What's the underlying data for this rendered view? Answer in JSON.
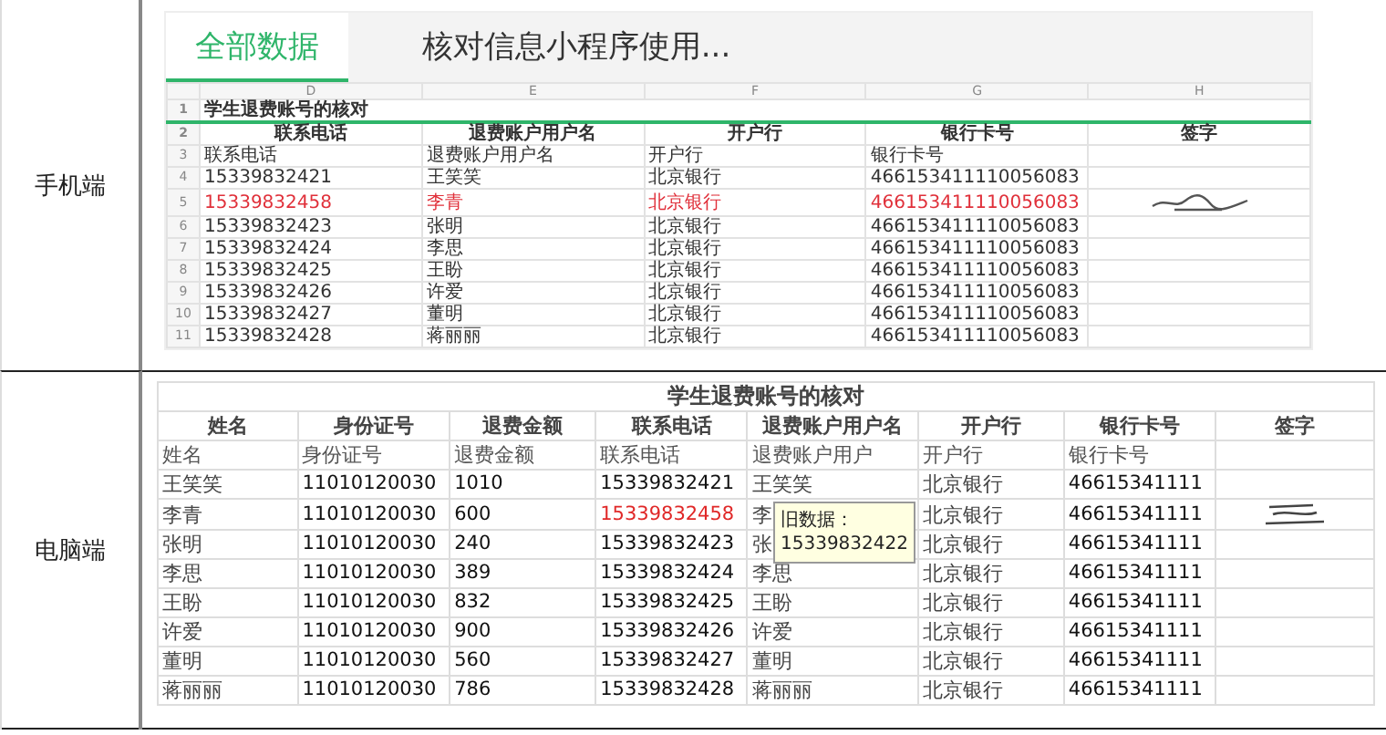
{
  "mobile": {
    "label": "手机端",
    "tabs": [
      {
        "label": "全部数据",
        "selected": true
      },
      {
        "label": "核对信息小程序使用...",
        "selected": false
      }
    ],
    "column_letters": [
      "D",
      "E",
      "F",
      "G",
      "H"
    ],
    "row_numbers": [
      "1",
      "2",
      "3",
      "4",
      "5",
      "6",
      "7",
      "8",
      "9",
      "10",
      "11"
    ],
    "title": "学生退费账号的核对",
    "header": [
      "联系电话",
      "退费账户用户名",
      "开户行",
      "银行卡号",
      "签字"
    ],
    "subheader": [
      "联系电话",
      "退费账户用户名",
      "开户行",
      "银行卡号"
    ],
    "rows": [
      {
        "cells": [
          "15339832421",
          "王笑笑",
          "北京银行",
          "466153411110056083"
        ],
        "changed": false,
        "signed": false
      },
      {
        "cells": [
          "15339832458",
          "李青",
          "北京银行",
          "466153411110056083"
        ],
        "changed": true,
        "signed": true
      },
      {
        "cells": [
          "15339832423",
          "张明",
          "北京银行",
          "466153411110056083"
        ],
        "changed": false,
        "signed": false
      },
      {
        "cells": [
          "15339832424",
          "李思",
          "北京银行",
          "466153411110056083"
        ],
        "changed": false,
        "signed": false
      },
      {
        "cells": [
          "15339832425",
          "王盼",
          "北京银行",
          "466153411110056083"
        ],
        "changed": false,
        "signed": false
      },
      {
        "cells": [
          "15339832426",
          "许爱",
          "北京银行",
          "466153411110056083"
        ],
        "changed": false,
        "signed": false
      },
      {
        "cells": [
          "15339832427",
          "董明",
          "北京银行",
          "466153411110056083"
        ],
        "changed": false,
        "signed": false
      },
      {
        "cells": [
          "15339832428",
          "蒋丽丽",
          "北京银行",
          "466153411110056083"
        ],
        "changed": false,
        "signed": false
      }
    ]
  },
  "desktop": {
    "label": "电脑端",
    "title": "学生退费账号的核对",
    "header": [
      "姓名",
      "身份证号",
      "退费金额",
      "联系电话",
      "退费账户用户名",
      "开户行",
      "银行卡号",
      "签字"
    ],
    "subheader": [
      "姓名",
      "身份证号",
      "退费金额",
      "联系电话",
      "退费账户用户",
      "开户行",
      "银行卡号"
    ],
    "tooltip": "旧数据：15339832422",
    "rows": [
      {
        "cells": [
          "王笑笑",
          "11010120030",
          "1010",
          "15339832421",
          "王笑笑",
          "北京银行",
          "46615341111"
        ],
        "changed": false,
        "signed": false
      },
      {
        "cells": [
          "李青",
          "11010120030",
          "600",
          "15339832458",
          "李",
          "北京银行",
          "46615341111"
        ],
        "changed": true,
        "signed": true
      },
      {
        "cells": [
          "张明",
          "11010120030",
          "240",
          "15339832423",
          "张",
          "北京银行",
          "46615341111"
        ],
        "changed": false,
        "signed": false
      },
      {
        "cells": [
          "李思",
          "11010120030",
          "389",
          "15339832424",
          "李思",
          "北京银行",
          "46615341111"
        ],
        "changed": false,
        "signed": false
      },
      {
        "cells": [
          "王盼",
          "11010120030",
          "832",
          "15339832425",
          "王盼",
          "北京银行",
          "46615341111"
        ],
        "changed": false,
        "signed": false
      },
      {
        "cells": [
          "许爱",
          "11010120030",
          "900",
          "15339832426",
          "许爱",
          "北京银行",
          "46615341111"
        ],
        "changed": false,
        "signed": false
      },
      {
        "cells": [
          "董明",
          "11010120030",
          "560",
          "15339832427",
          "董明",
          "北京银行",
          "46615341111"
        ],
        "changed": false,
        "signed": false
      },
      {
        "cells": [
          "蒋丽丽",
          "11010120030",
          "786",
          "15339832428",
          "蒋丽丽",
          "北京银行",
          "46615341111"
        ],
        "changed": false,
        "signed": false
      }
    ]
  }
}
